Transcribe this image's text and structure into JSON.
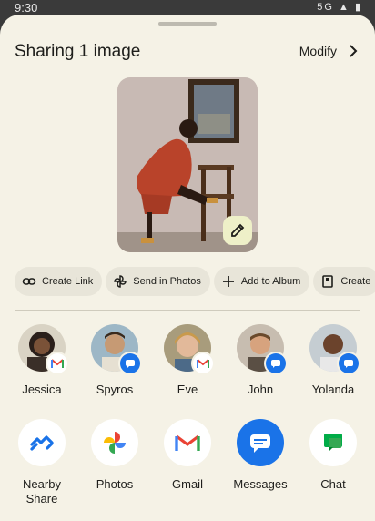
{
  "status": {
    "time": "9:30",
    "icons": "5G ▲ ▮"
  },
  "header": {
    "title": "Sharing 1 image",
    "modify_label": "Modify"
  },
  "actions": [
    {
      "label": "Create Link",
      "icon": "link-icon"
    },
    {
      "label": "Send in Photos",
      "icon": "pinwheel-icon"
    },
    {
      "label": "Add to Album",
      "icon": "plus-icon"
    },
    {
      "label": "Create",
      "icon": "book-icon"
    }
  ],
  "people": [
    {
      "name": "Jessica",
      "badge": "gmail-icon"
    },
    {
      "name": "Spyros",
      "badge": "messages-icon"
    },
    {
      "name": "Eve",
      "badge": "gmail-icon"
    },
    {
      "name": "John",
      "badge": "messages-icon"
    },
    {
      "name": "Yolanda",
      "badge": "messages-icon"
    }
  ],
  "apps": [
    {
      "name": "Nearby\nShare",
      "line1": "Nearby",
      "line2": "Share",
      "icon": "nearby-share-icon"
    },
    {
      "name": "Photos",
      "line1": "Photos",
      "icon": "photos-icon"
    },
    {
      "name": "Gmail",
      "line1": "Gmail",
      "icon": "gmail-icon"
    },
    {
      "name": "Messages",
      "line1": "Messages",
      "icon": "messages-icon"
    },
    {
      "name": "Chat",
      "line1": "Chat",
      "icon": "chat-icon"
    }
  ],
  "colors": {
    "sheet": "#f5f2e6",
    "chip": "#e8e5d9",
    "accent": "#1a73e8",
    "edit": "#eef0c8"
  }
}
